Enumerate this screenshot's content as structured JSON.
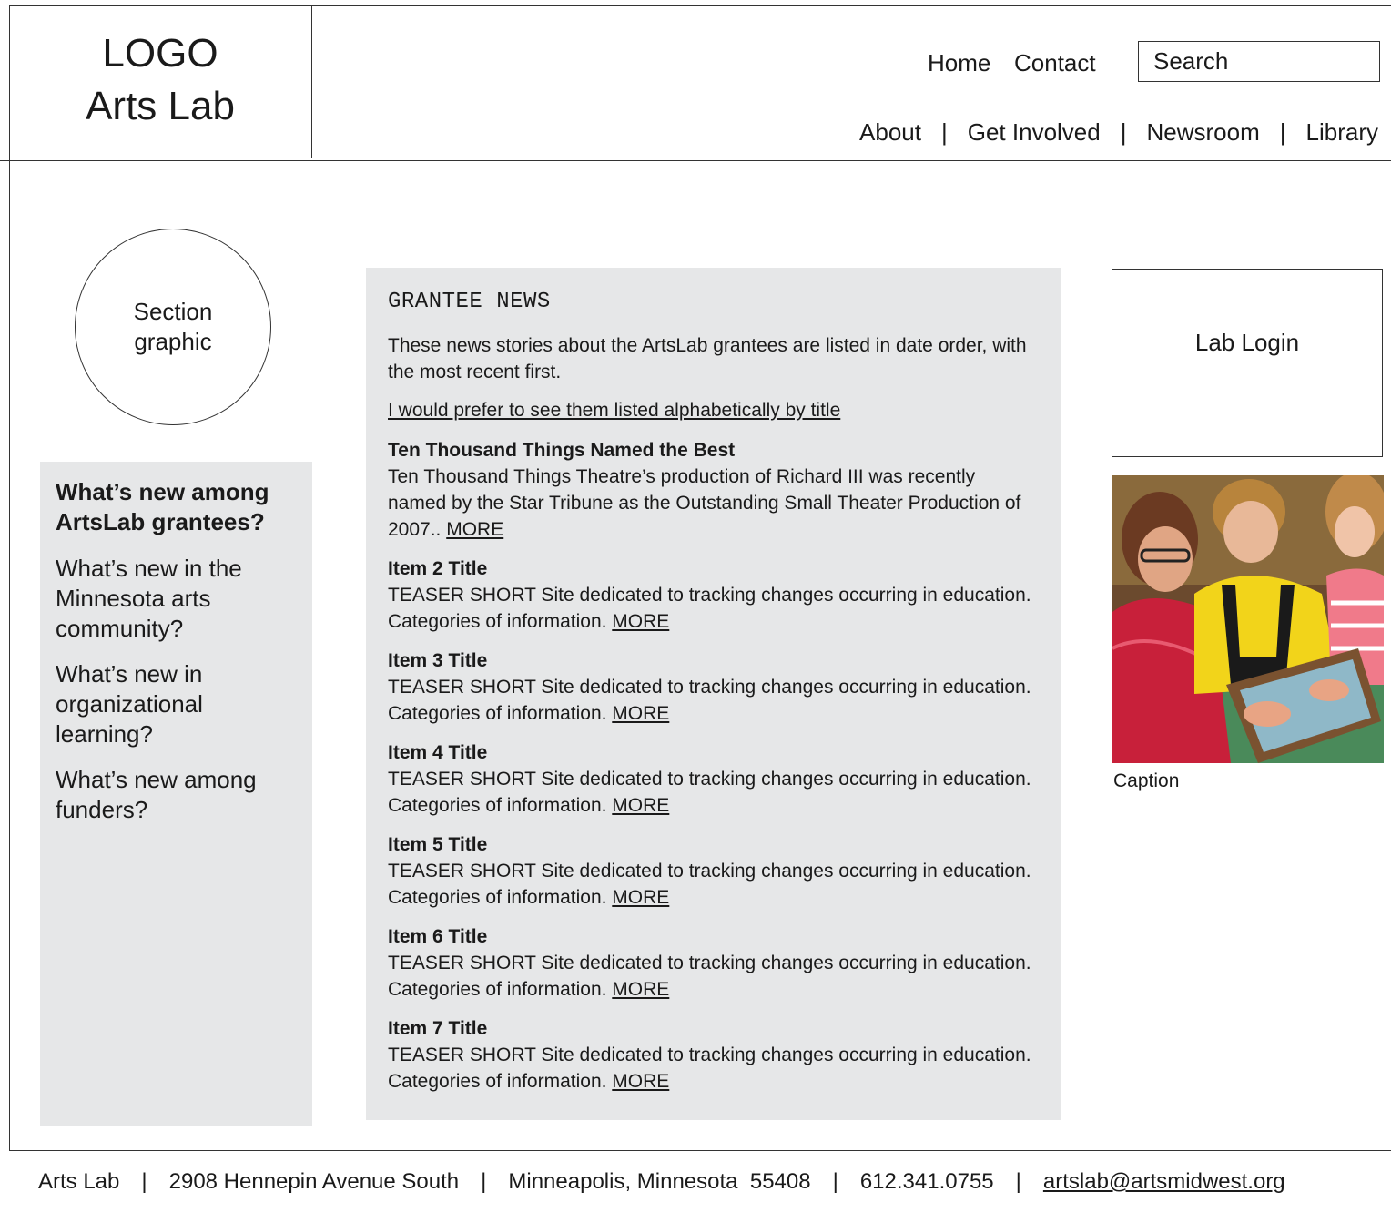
{
  "logo": {
    "line1": "LOGO",
    "line2": "Arts Lab"
  },
  "utility_nav": {
    "home": "Home",
    "contact": "Contact"
  },
  "search": {
    "placeholder": "Search"
  },
  "main_nav": {
    "items": [
      "About",
      "Get Involved",
      "Newsroom",
      "Library"
    ],
    "separator": "|"
  },
  "section_graphic": {
    "label": "Section\ngraphic"
  },
  "left_nav": {
    "items": [
      "What’s new among ArtsLab grantees?",
      "What’s new in the Minnesota arts community?",
      "What’s new in organizational learning?",
      "What’s new among funders?"
    ],
    "active_index": 0
  },
  "main": {
    "heading": "GRANTEE NEWS",
    "intro": "These news stories about the ArtsLab grantees are listed in date order, with the most recent first.",
    "sort_link": "I would prefer to see them listed alphabetically by title",
    "more_label": "MORE",
    "items": [
      {
        "title": "Ten Thousand Things Named the Best",
        "text": "Ten Thousand Things Theatre’s production of Richard III was recently named by the Star Tribune as the Outstanding Small Theater Production of 2007.. "
      },
      {
        "title": "Item 2 Title",
        "text": "TEASER SHORT Site dedicated to tracking changes occurring in education. Categories of information. "
      },
      {
        "title": "Item 3 Title",
        "text": "TEASER SHORT Site dedicated to tracking changes occurring in education. Categories of information. "
      },
      {
        "title": "Item 4 Title",
        "text": "TEASER SHORT Site dedicated to tracking changes occurring in education. Categories of information. "
      },
      {
        "title": "Item 5 Title",
        "text": "TEASER SHORT Site dedicated to tracking changes occurring in education. Categories of information. "
      },
      {
        "title": "Item 6 Title",
        "text": "TEASER SHORT Site dedicated to tracking changes occurring in education. Categories of information. "
      },
      {
        "title": "Item 7 Title",
        "text": "TEASER SHORT Site dedicated to tracking changes occurring in education. Categories of information. "
      }
    ]
  },
  "sidebar": {
    "login_label": "Lab Login",
    "caption": "Caption"
  },
  "footer": {
    "name": "Arts Lab",
    "address": "2908 Hennepin Avenue South",
    "city": "Minneapolis, Minnesota  55408",
    "phone": "612.341.0755",
    "email": "artslab@artsmidwest.org",
    "separator": "|"
  },
  "colors": {
    "panel_bg": "#e6e7e8",
    "border": "#333333",
    "text": "#1a1a1a"
  }
}
